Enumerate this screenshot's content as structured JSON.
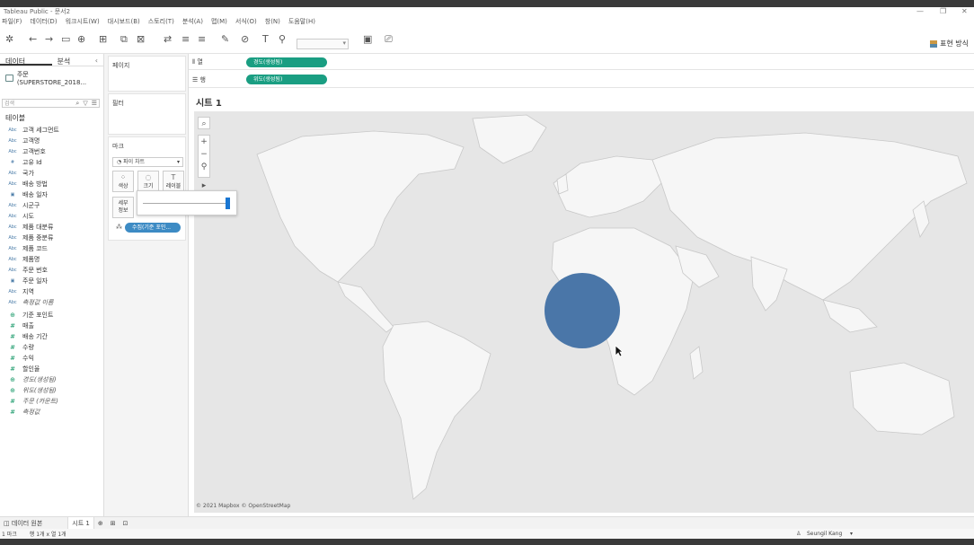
{
  "app": {
    "title": "Tableau Public - 문서2",
    "menu": [
      "파일(F)",
      "데이터(D)",
      "워크시트(W)",
      "대시보드(B)",
      "스토리(T)",
      "분석(A)",
      "맵(M)",
      "서식(O)",
      "창(N)",
      "도움말(H)"
    ]
  },
  "toolbar": {
    "show_me_label": "표현 방식"
  },
  "data_pane": {
    "tabs": [
      "데이터",
      "분석"
    ],
    "datasource": "주문 (SUPERSTORE_2018...",
    "search_placeholder": "검색",
    "tables_label": "테이블",
    "dimensions": [
      {
        "type": "Abc",
        "name": "고객 세그먼트"
      },
      {
        "type": "Abc",
        "name": "고객명"
      },
      {
        "type": "Abc",
        "name": "고객번호"
      },
      {
        "type": "#",
        "name": "고유 Id"
      },
      {
        "type": "Abc",
        "name": "국가"
      },
      {
        "type": "Abc",
        "name": "배송 방법"
      },
      {
        "type": "date",
        "name": "배송 일자"
      },
      {
        "type": "Abc",
        "name": "시군구"
      },
      {
        "type": "Abc",
        "name": "시도"
      },
      {
        "type": "Abc",
        "name": "제품 대분류"
      },
      {
        "type": "Abc",
        "name": "제품 중분류"
      },
      {
        "type": "Abc",
        "name": "제품 코드"
      },
      {
        "type": "Abc",
        "name": "제품명"
      },
      {
        "type": "Abc",
        "name": "주문 번호"
      },
      {
        "type": "date",
        "name": "주문 일자"
      },
      {
        "type": "Abc",
        "name": "지역"
      },
      {
        "type": "Abc",
        "name": "측정값 이름",
        "italic": true
      }
    ],
    "measures": [
      {
        "type": "geo",
        "name": "기준 포인트"
      },
      {
        "type": "#",
        "name": "매출"
      },
      {
        "type": "#",
        "name": "배송 기간"
      },
      {
        "type": "#",
        "name": "수량"
      },
      {
        "type": "#",
        "name": "수익"
      },
      {
        "type": "#",
        "name": "할인율"
      },
      {
        "type": "geo",
        "name": "경도(생성됨)",
        "italic": true
      },
      {
        "type": "geo",
        "name": "위도(생성됨)",
        "italic": true
      },
      {
        "type": "#",
        "name": "주문 (카운트)",
        "italic": true
      },
      {
        "type": "#",
        "name": "측정값",
        "italic": true
      }
    ]
  },
  "cards": {
    "pages": "페이지",
    "filters": "필터",
    "marks": "마크",
    "marks_type": "파이 차트",
    "buttons": [
      "색상",
      "크기",
      "레이블"
    ],
    "detail": "세부\n정보",
    "marks_pill": "수집(기준 포인..."
  },
  "shelves": {
    "columns_label": "열",
    "columns_pill": "경도(생성됨)",
    "rows_label": "행",
    "rows_pill": "위도(생성됨)"
  },
  "sheet": {
    "title": "시트 1",
    "attribution": "© 2021 Mapbox © OpenStreetMap",
    "mark_color": "#4a76a8",
    "size_slider_level": 0.98
  },
  "bottom_tabs": {
    "data_source": "데이터 원본",
    "sheet": "시트 1"
  },
  "status": {
    "marks": "1 마크",
    "rows_cols": "행 1개 x 열 1개",
    "user": "Seungil Kang"
  }
}
